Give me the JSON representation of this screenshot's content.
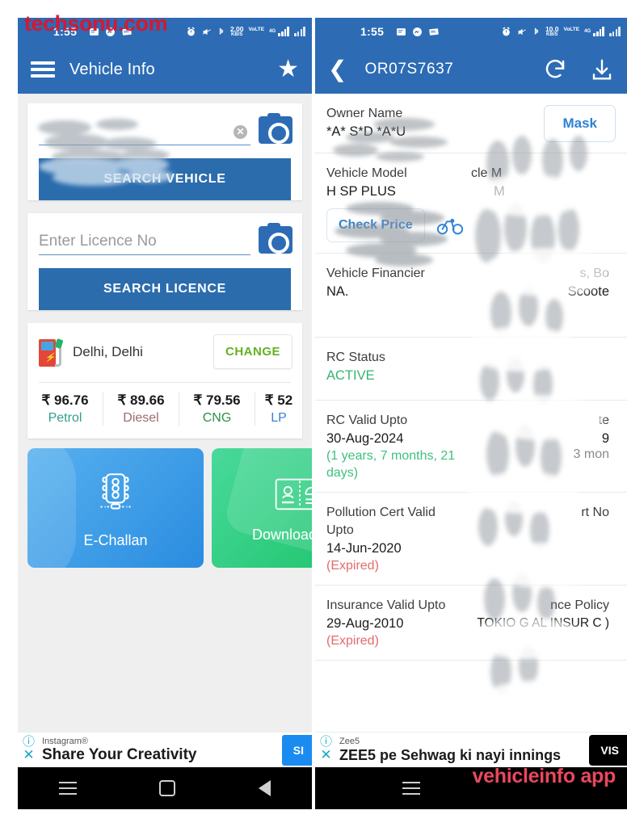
{
  "left": {
    "watermark": "techsonu.com",
    "status": {
      "time": "1:55",
      "net_speed": "2.00",
      "net_unit": "KB/S",
      "volte": "VoLTE",
      "network": "4G"
    },
    "appbar": {
      "title": "Vehicle Info",
      "menu_icon": "hamburger-icon",
      "favorite_icon": "star-icon"
    },
    "vehicle_search": {
      "input_value": "",
      "placeholder": "",
      "clear_icon": "clear-x-icon",
      "camera_icon": "camera-icon",
      "button_label": "SEARCH VEHICLE"
    },
    "licence_search": {
      "placeholder": "Enter Licence No",
      "camera_icon": "camera-icon",
      "button_label": "SEARCH LICENCE"
    },
    "fuel": {
      "city": "Delhi, Delhi",
      "pump_icon": "fuel-pump-icon",
      "change_label": "CHANGE",
      "prices": [
        {
          "price": "₹ 96.76",
          "label": "Petrol",
          "color": "#2f9e8f"
        },
        {
          "price": "₹ 89.66",
          "label": "Diesel",
          "color": "#9c6b6b"
        },
        {
          "price": "₹ 79.56",
          "label": "CNG",
          "color": "#2f8f4a"
        },
        {
          "price": "₹ 52",
          "label": "LP",
          "color": "#3a7fd5"
        }
      ]
    },
    "tiles": [
      {
        "label": "E-Challan",
        "icon": "traffic-light-icon",
        "color": "#2a8ce0"
      },
      {
        "label": "Downloaded R",
        "icon": "id-card-icon",
        "color": "#19c268"
      }
    ],
    "ad": {
      "brand": "Instagram®",
      "title": "Share Your Creativity",
      "cta": "SI",
      "info_icon": "info-icon",
      "close_icon": "close-icon"
    },
    "navbar": {
      "recents_icon": "recents-icon",
      "home_icon": "home-icon",
      "back_icon": "back-icon"
    }
  },
  "right": {
    "watermark": "vehicleinfo app",
    "status": {
      "time": "1:55",
      "net_speed": "10.0",
      "net_unit": "KB/S",
      "volte": "VoLTE",
      "network": "4G"
    },
    "appbar": {
      "title": "OR07S7637",
      "back_icon": "back-arrow-icon",
      "refresh_icon": "refresh-icon",
      "download_icon": "download-icon"
    },
    "rows": [
      {
        "label": "Owner Name",
        "value": "*A*           S*D *A*U",
        "action": "Mask",
        "right_label": "",
        "right_value": ""
      },
      {
        "label": "Vehicle Model",
        "value": "H SP PLUS",
        "action": "Check Price",
        "action_icon": "bicycle-icon",
        "right_label": "cle M",
        "right_value": "M"
      },
      {
        "label": "Vehicle Financier",
        "value": "NA.",
        "right_label": "s, Bo",
        "right_value": "Scoote"
      },
      {
        "label": "RC Status",
        "value": "ACTIVE",
        "value_color": "green",
        "right_label": "",
        "right_value": ""
      },
      {
        "label": "RC Valid Upto",
        "value": "30-Aug-2024",
        "sub": "(1 years, 7 months, 21 days)",
        "sub_color": "green",
        "right_label": "te",
        "right_value": "9",
        "right_sub": "3 mon"
      },
      {
        "label": "Pollution Cert Valid Upto",
        "value": "14-Jun-2020",
        "sub": "(Expired)",
        "sub_color": "red",
        "right_label": "rt No",
        "right_value": ""
      },
      {
        "label": "Insurance Valid Upto",
        "value": "29-Aug-2010",
        "sub": "(Expired)",
        "sub_color": "red",
        "right_label": "nce Policy",
        "right_value": "TOKIO G AL INSUR C )"
      }
    ],
    "ad": {
      "brand": "Zee5",
      "title": "ZEE5 pe Sehwag ki nayi innings",
      "cta": "VIS",
      "info_icon": "info-icon",
      "close_icon": "close-icon"
    },
    "navbar": {
      "recents_icon": "recents-icon"
    }
  },
  "colors": {
    "primary": "#2d6cb5",
    "button": "#2b6cad",
    "green": "#3ec17d",
    "red": "#e46b6b",
    "link": "#2f82d4"
  }
}
